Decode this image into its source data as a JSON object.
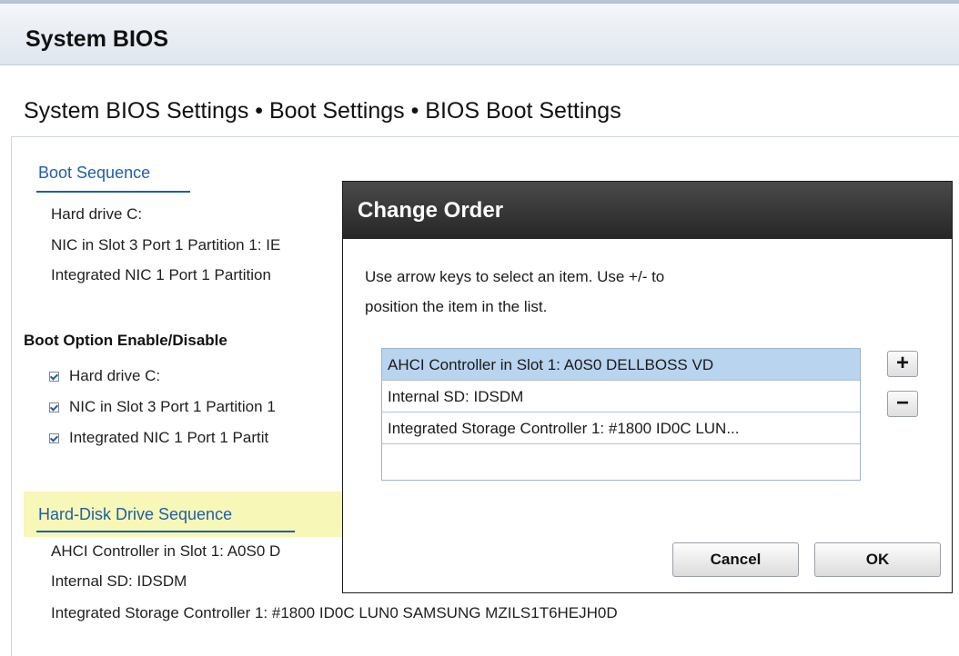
{
  "header": {
    "title": "System BIOS"
  },
  "breadcrumb": "System BIOS Settings • Boot Settings • BIOS Boot Settings",
  "boot_sequence": {
    "label": "Boot Sequence",
    "items": [
      "Hard drive C:",
      "NIC in Slot 3 Port 1 Partition 1: IE",
      "Integrated NIC 1 Port 1 Partition"
    ]
  },
  "boot_options": {
    "label": "Boot Option Enable/Disable",
    "items": [
      {
        "label": "Hard drive C:",
        "checked": true
      },
      {
        "label": "NIC in Slot 3 Port 1 Partition 1",
        "checked": true
      },
      {
        "label": "Integrated NIC 1 Port 1 Partit",
        "checked": true
      }
    ]
  },
  "hdd_sequence": {
    "label": "Hard-Disk Drive Sequence",
    "items": [
      "AHCI Controller in Slot 1: A0S0 D",
      "Internal SD: IDSDM",
      "Integrated Storage Controller 1: #1800 ID0C LUN0 SAMSUNG  MZILS1T6HEJH0D"
    ]
  },
  "dialog": {
    "title": "Change Order",
    "instructions_line1": "Use arrow keys to select an item. Use +/- to",
    "instructions_line2": "position the item in the list.",
    "list": [
      "AHCI Controller in Slot 1: A0S0 DELLBOSS VD",
      "Internal SD: IDSDM",
      "Integrated Storage Controller 1: #1800 ID0C LUN..."
    ],
    "selected_index": 0,
    "plus_label": "+",
    "minus_label": "−",
    "cancel_label": "Cancel",
    "ok_label": "OK"
  },
  "colors": {
    "link": "#1f5fa8",
    "selection": "#b8d4ee",
    "highlight": "#f7f7b8",
    "dialog_header": "#2f2f2f"
  }
}
